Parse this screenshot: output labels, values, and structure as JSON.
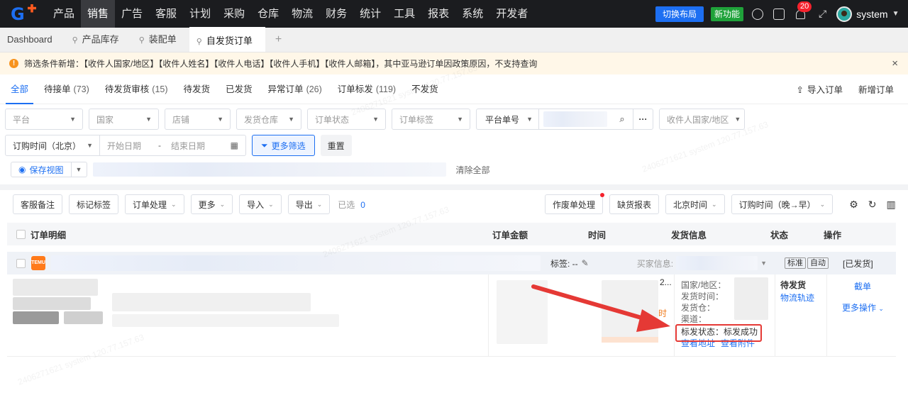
{
  "topnav": {
    "items": [
      "产品",
      "销售",
      "广告",
      "客服",
      "计划",
      "采购",
      "仓库",
      "物流",
      "财务",
      "统计",
      "工具",
      "报表",
      "系统",
      "开发者"
    ],
    "active_index": 1,
    "switch_layout": "切换布局",
    "new_feature": "新功能",
    "notification_count": "20",
    "username": "system",
    "accent_color": "#1d6ff2",
    "icons": [
      "help-icon",
      "task-icon",
      "bell-icon",
      "fullscreen-icon"
    ]
  },
  "tabs": {
    "items": [
      "Dashboard",
      "产品库存",
      "装配单",
      "自发货订单"
    ],
    "active_index": 3,
    "add": "+"
  },
  "notice": {
    "icon": "!",
    "text": "筛选条件新增：【收件人国家/地区】【收件人姓名】【收件人电话】【收件人手机】【收件人邮箱】，其中亚马逊订单因政策原因，不支持查询",
    "close": "×"
  },
  "status_tabs": [
    {
      "label": "全部",
      "count": ""
    },
    {
      "label": "待接单",
      "count": "(73)"
    },
    {
      "label": "待发货审核",
      "count": "(15)"
    },
    {
      "label": "待发货",
      "count": ""
    },
    {
      "label": "已发货",
      "count": ""
    },
    {
      "label": "异常订单",
      "count": "(26)"
    },
    {
      "label": "订单标发",
      "count": "(119)"
    },
    {
      "label": "不发货",
      "count": ""
    }
  ],
  "top_actions": {
    "import": "导入订单",
    "create": "新增订单"
  },
  "filters": {
    "row1": [
      "平台",
      "国家",
      "店铺",
      "发货仓库",
      "订单状态",
      "订单标签"
    ],
    "search_prefix": "平台单号",
    "recipient_country": "收件人国家/地区",
    "time_type": "订购时间（北京）",
    "start_date": "开始日期",
    "date_sep": "-",
    "end_date": "结束日期",
    "more_filters": "更多筛选",
    "reset": "重置",
    "save_view": "保存视图",
    "clear_all": "清除全部"
  },
  "toolbar": {
    "left": [
      "客服备注",
      "标记标签",
      "订单处理",
      "更多",
      "导入",
      "导出"
    ],
    "left_dropdown": [
      false,
      false,
      true,
      true,
      true,
      true
    ],
    "selected_label": "已选",
    "selected_count": "0",
    "right": [
      "作废单处理",
      "缺货报表",
      "北京时间",
      "订购时间（晚→早）"
    ],
    "right_dropdown": [
      false,
      false,
      true,
      true
    ]
  },
  "table": {
    "headers": {
      "detail": "订单明细",
      "amount": "订单金额",
      "time": "时间",
      "shipping": "发货信息",
      "status": "状态",
      "ops": "操作"
    },
    "order": {
      "shop_logo_text": "TEMU",
      "tag_label": "标签: --",
      "buyer_label": "买家信息:",
      "tag_standard": "标准",
      "tag_auto": "自动",
      "shipped_tag": "[已发货]",
      "time_fragment": "2...",
      "time_suffix": "时",
      "country_label": "国家/地区：",
      "ship_time_label": "发货时间：",
      "warehouse_label": "发货仓：",
      "channel_label": "渠道：",
      "mark_status_label": "标发状态：",
      "mark_status_value": "标发成功",
      "view_address": "查看地址",
      "view_attachment": "查看附件",
      "status": "待发货",
      "track": "物流轨迹",
      "cut_order": "截单",
      "more_ops": "更多操作"
    }
  },
  "watermark_text": "2406271621 system 120.77.157.63"
}
